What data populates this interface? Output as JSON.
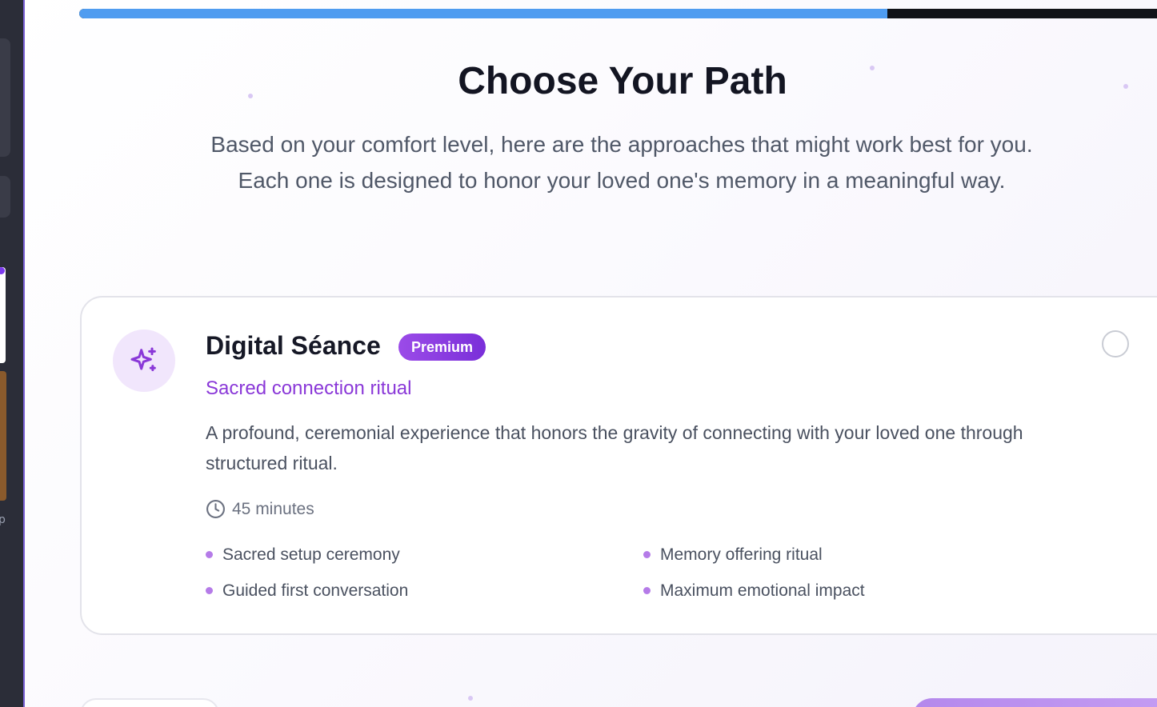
{
  "progress": {
    "value_percent": 75
  },
  "page": {
    "title": "Choose Your Path",
    "subtitle": "Based on your comfort level, here are the approaches that might work best for you. Each one is designed to honor your loved one's memory in a meaningful way."
  },
  "options": [
    {
      "icon": "sparkles-icon",
      "title": "Digital Séance",
      "badge": "Premium",
      "tagline": "Sacred connection ritual",
      "description": "A profound, ceremonial experience that honors the gravity of connecting with your loved one through structured ritual.",
      "duration": "45 minutes",
      "features": [
        "Sacred setup ceremony",
        "Memory offering ritual",
        "Guided first conversation",
        "Maximum emotional impact"
      ],
      "selected": false
    }
  ],
  "colors": {
    "accent": "#8a38d8",
    "badge": "#8b3fe2",
    "progress_fill": "#4f9cf0",
    "progress_track": "#111318",
    "title": "#131522",
    "body_text": "#4a5160"
  }
}
